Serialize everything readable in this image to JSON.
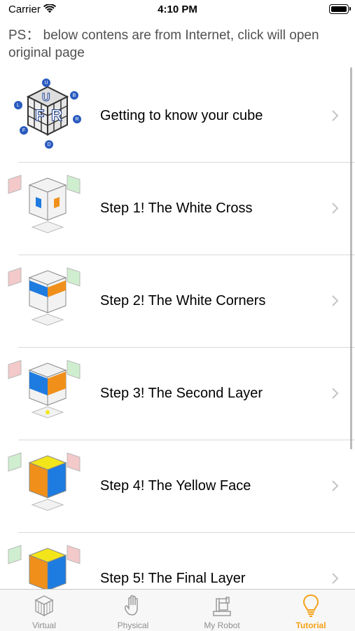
{
  "status_bar": {
    "carrier": "Carrier",
    "time": "4:10 PM"
  },
  "notice": "PS： below contens are from Internet, click will open original page",
  "tutorials": [
    {
      "label": "Getting to know your cube",
      "thumb_icon": "cube-notation-icon"
    },
    {
      "label": "Step 1! The White Cross",
      "thumb_icon": "white-cross-icon"
    },
    {
      "label": "Step 2! The White Corners",
      "thumb_icon": "white-corners-icon"
    },
    {
      "label": "Step 3! The Second Layer",
      "thumb_icon": "second-layer-icon"
    },
    {
      "label": "Step 4! The Yellow Face",
      "thumb_icon": "yellow-face-icon"
    },
    {
      "label": "Step 5! The Final Layer",
      "thumb_icon": "final-layer-icon"
    }
  ],
  "tabs": [
    {
      "label": "Virtual",
      "icon": "cube-icon",
      "active": false
    },
    {
      "label": "Physical",
      "icon": "hand-icon",
      "active": false
    },
    {
      "label": "My Robot",
      "icon": "robot-icon",
      "active": false
    },
    {
      "label": "Tutorial",
      "icon": "lightbulb-icon",
      "active": true
    }
  ],
  "colors": {
    "accent": "#f5a117",
    "tab_inactive": "#8e8e93",
    "separator": "#d9d9d9",
    "cube_white": "#f2f2f2",
    "cube_blue": "#1e7be0",
    "cube_orange": "#f0901a",
    "cube_yellow": "#f2e51a",
    "cube_red": "#e57373",
    "cube_green": "#8ddc8d"
  }
}
